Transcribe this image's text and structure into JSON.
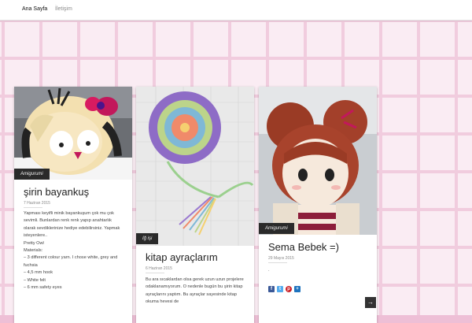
{
  "nav": {
    "home": "Ana Sayfa",
    "contact": "İletişim"
  },
  "posts": [
    {
      "category": "Amigurumi",
      "title": "şirin bayankuş",
      "date": "7 Haziran 2015",
      "body": [
        "Yapması keyifli minik bayankuşum çok mu çok sevimli. Bunlardan renk renk yapıp anahtarlık olarak sevdiklerinize hediye edebilirsiniz. Yapmak isteyenlere..",
        "Pretty Owl",
        "Materials:",
        "– 3 different colour yarn. I chose white, grey and fuchsia",
        "– 4,5 mm hook",
        "– White felt",
        "– 6 mm safety eyes"
      ]
    },
    {
      "category": "Iğ işi",
      "title": "kitap ayraçlarım",
      "date": "6 Haziran 2015",
      "body": [
        "Bu ara sıcaklardan olsa gerek uzun uzun projelere odaklanamıyorum. O nedenle bugün bu şirin kitap ayraçlarını yaptım. Bu ayraçlar sayesinde kitap okuma hevesi de"
      ]
    },
    {
      "category": "Amigurumi",
      "title": "Sema Bebek =)",
      "date": "29 Mayıs 2015",
      "body": [
        "."
      ]
    }
  ],
  "share_icons": [
    "facebook-icon",
    "twitter-icon",
    "pinterest-icon",
    "plus-share-icon"
  ],
  "next_label": "→",
  "colors": {
    "background": "#eebfd6",
    "tag_bg": "#2a2a2a",
    "facebook": "#3b5998",
    "twitter": "#55acee",
    "pinterest": "#cb2027",
    "share": "#1e73be"
  }
}
